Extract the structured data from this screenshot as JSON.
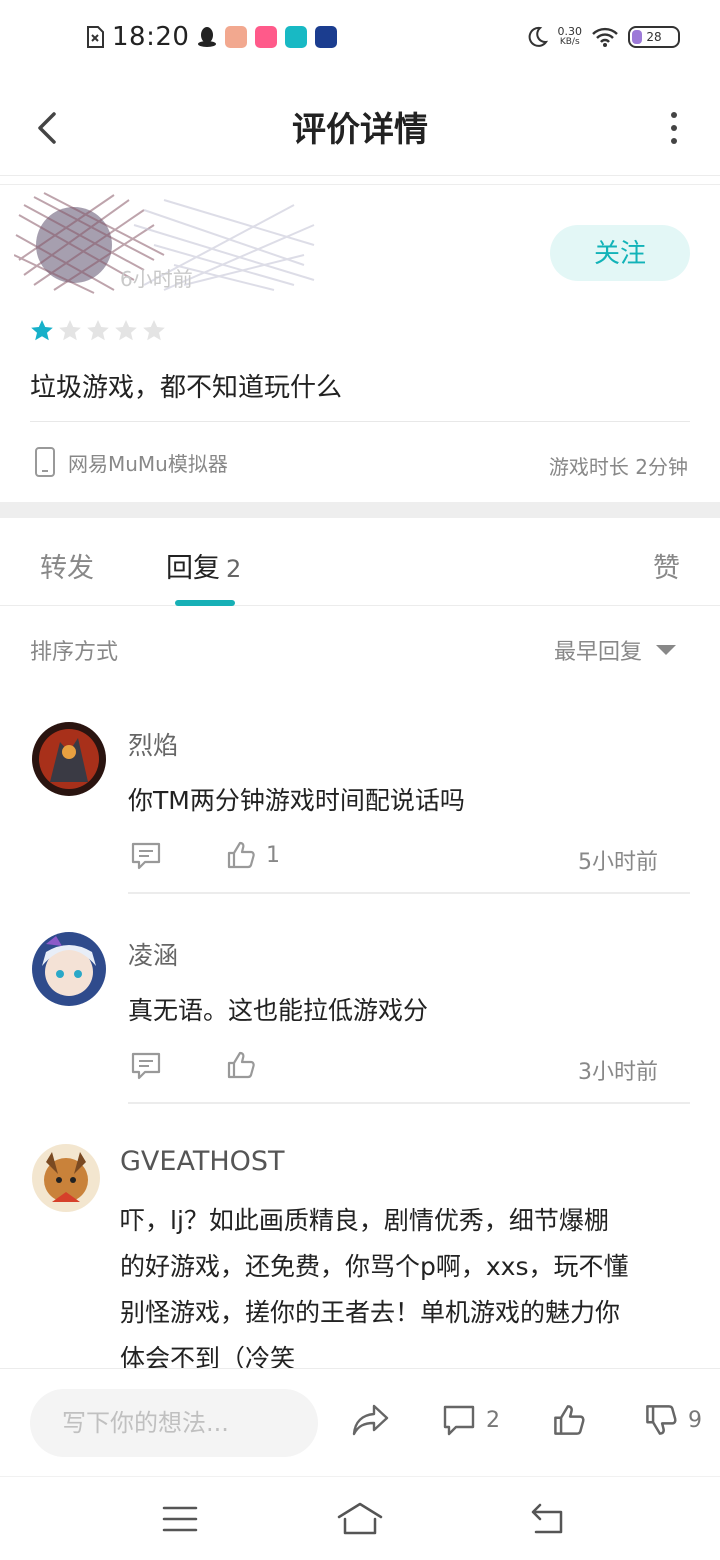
{
  "status_bar": {
    "time": "18:20",
    "net_speed_value": "0.30",
    "net_speed_unit": "KB/s",
    "battery": "28",
    "colors": {
      "battery_fill": "#9d7ad8"
    },
    "app_icons": [
      "qq-icon",
      "app-icon-avatar",
      "app-icon-pink",
      "taptap-icon",
      "app-icon-blue"
    ]
  },
  "header": {
    "title": "评价详情",
    "back_icon": "chevron-left-icon",
    "more_icon": "more-vertical-icon"
  },
  "review": {
    "time": "6小时前",
    "follow_label": "关注",
    "rating": 1,
    "rating_max": 5,
    "text": "垃圾游戏，都不知道玩什么",
    "device": "网易MuMu模拟器",
    "playtime": "游戏时长 2分钟",
    "colors": {
      "accent": "#12b3b8",
      "follow_bg": "#e3f7f6",
      "star_on": "#17b0c9",
      "star_off": "#e4e4e4"
    }
  },
  "tabs": [
    {
      "label": "转发"
    },
    {
      "label": "回复",
      "count": "2"
    },
    {
      "label": "赞"
    }
  ],
  "sort": {
    "label": "排序方式",
    "selected": "最早回复"
  },
  "replies": [
    {
      "name": "烈焰",
      "text": "你TM两分钟游戏时间配说话吗",
      "likes": "1",
      "time": "5小时前"
    },
    {
      "name": "凌涵",
      "text": "真无语。这也能拉低游戏分",
      "likes": "",
      "time": "3小时前"
    },
    {
      "name": "GVEATHOST",
      "lines": [
        "吓，lj？如此画质精良，剧情优秀，细节爆棚",
        "的好游戏，还免费，你骂个p啊，xxs，玩不懂",
        "别怪游戏，搓你的王者去！单机游戏的魅力你",
        "体会不到（冷笑"
      ]
    }
  ],
  "bottom_bar": {
    "placeholder": "写下你的想法...",
    "comment_count": "2",
    "dislike_count": "9"
  }
}
